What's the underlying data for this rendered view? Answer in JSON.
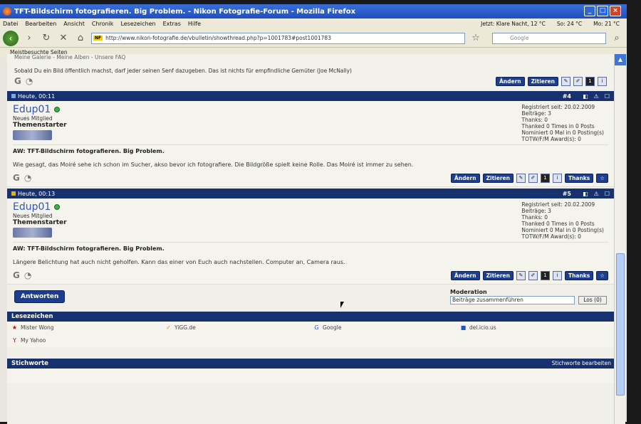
{
  "window": {
    "title": "TFT-Bildschirm fotografieren. Big Problem. - Nikon Fotografie-Forum - Mozilla Firefox"
  },
  "menu": [
    "Datei",
    "Bearbeiten",
    "Ansicht",
    "Chronik",
    "Lesezeichen",
    "Extras",
    "Hilfe"
  ],
  "status": {
    "weather1": "Jetzt: Klare Nacht, 12 °C",
    "weather2": "So: 24 °C",
    "weather3": "Mo: 21 °C"
  },
  "nav": {
    "url": "http://www.nikon-fotografie.de/vbulletin/showthread.php?p=1001783#post1001783",
    "url_badge": "NF",
    "search_placeholder": "Google"
  },
  "bookmarks_toolbar": {
    "item": "Meistbesuchte Seiten"
  },
  "top_post": {
    "sig_header": "Meine Galerie - Meine Alben - Unsere FAQ",
    "signature": "Sobald Du ein Bild öffentlich machst, darf jeder seinen Senf dazugeben. Das ist nichts für empfindliche Gemüter (Joe McNally)",
    "btn_edit": "Ändern",
    "btn_quote": "Zitieren"
  },
  "posts": [
    {
      "time": "Heute, 00:11",
      "number": "#4",
      "username": "Edup01",
      "rank": "Neues Mitglied",
      "role": "Themenstarter",
      "stats": [
        "Registriert seit: 20.02.2009",
        "Beiträge: 3",
        "Thanks: 0",
        "Thanked 0 Times in 0 Posts",
        "Nominiert 0 Mal in 0 Posting(s)",
        "TOTW/F/M Award(s): 0"
      ],
      "title": "AW: TFT-Bildschirm fotografieren. Big Problem.",
      "text": "Wie gesagt, das Moiré sehe ich schon im Sucher, akso bevor ich fotografiere. Die Bildgröße spielt keine Rolle. Das Moiré ist immer zu sehen.",
      "btn_edit": "Ändern",
      "btn_quote": "Zitieren",
      "btn_thanks": "Thanks"
    },
    {
      "time": "Heute, 00:13",
      "number": "#5",
      "username": "Edup01",
      "rank": "Neues Mitglied",
      "role": "Themenstarter",
      "stats": [
        "Registriert seit: 20.02.2009",
        "Beiträge: 3",
        "Thanks: 0",
        "Thanked 0 Times in 0 Posts",
        "Nominiert 0 Mal in 0 Posting(s)",
        "TOTW/F/M Award(s): 0"
      ],
      "title": "AW: TFT-Bildschirm fotografieren. Big Problem.",
      "text": "Längere Belichtung hat auch nicht geholfen. Kann das einer von Euch auch nachstellen. Computer an, Camera raus.",
      "btn_edit": "Ändern",
      "btn_quote": "Zitieren",
      "btn_thanks": "Thanks"
    }
  ],
  "reply": {
    "button": "Antworten",
    "moderation_label": "Moderation",
    "moderation_select": "Beiträge zusammenführen",
    "moderation_go": "Los (0)"
  },
  "lesezeichen": {
    "title": "Lesezeichen",
    "items": [
      "Mister Wong",
      "YiGG.de",
      "Google",
      "del.icio.us",
      "My Yahoo"
    ]
  },
  "stichworte": {
    "title": "Stichworte",
    "edit": "Stichworte bearbeiten"
  }
}
